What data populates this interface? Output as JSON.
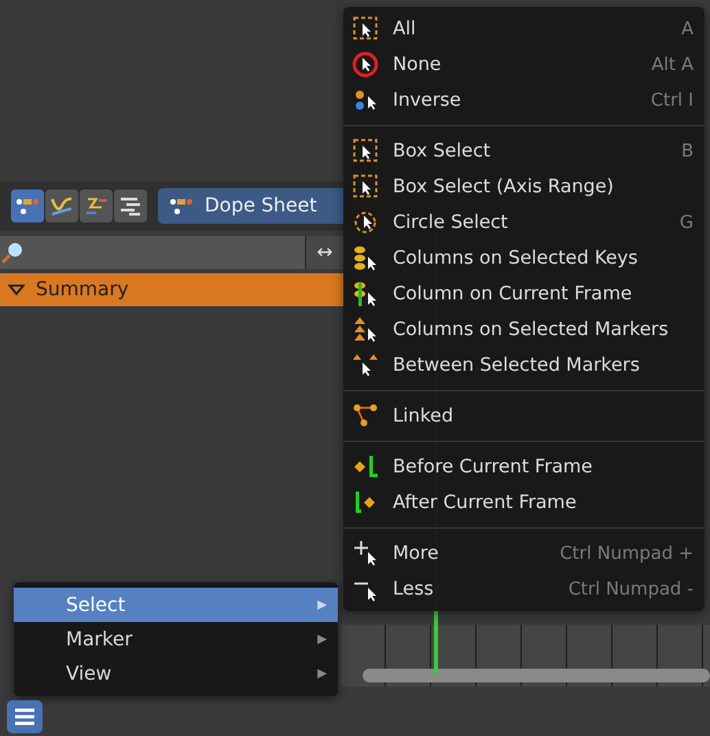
{
  "editor": {
    "type_buttons": [
      {
        "selected": true
      },
      {
        "selected": false
      },
      {
        "selected": false
      },
      {
        "selected": false
      }
    ],
    "editor_type": "Dope Sheet",
    "search": {
      "toggle": "↔"
    },
    "channels": [
      {
        "label": "Summary",
        "selected": true
      }
    ]
  },
  "select_menu": {
    "sections": [
      {
        "items": [
          {
            "label": "All",
            "shortcut": "A"
          },
          {
            "label": "None",
            "shortcut": "Alt A"
          },
          {
            "label": "Inverse",
            "shortcut": "Ctrl I"
          }
        ]
      },
      {
        "items": [
          {
            "label": "Box Select",
            "shortcut": "B"
          },
          {
            "label": "Box Select (Axis Range)"
          },
          {
            "label": "Circle Select",
            "shortcut": "G"
          },
          {
            "label": "Columns on Selected Keys"
          },
          {
            "label": "Column on Current Frame"
          },
          {
            "label": "Columns on Selected Markers"
          },
          {
            "label": "Between Selected Markers"
          }
        ]
      },
      {
        "items": [
          {
            "label": "Linked"
          }
        ]
      },
      {
        "items": [
          {
            "label": "Before Current Frame"
          },
          {
            "label": "After Current Frame"
          }
        ]
      },
      {
        "items": [
          {
            "label": "More",
            "shortcut": "Ctrl Numpad +"
          },
          {
            "label": "Less",
            "shortcut": "Ctrl Numpad -"
          }
        ]
      }
    ]
  },
  "header_menu": {
    "items": [
      {
        "label": "Select",
        "selected": true,
        "arrow": "▶"
      },
      {
        "label": "Marker",
        "selected": false,
        "arrow": "▶"
      },
      {
        "label": "View",
        "selected": false,
        "arrow": "▶"
      }
    ]
  }
}
